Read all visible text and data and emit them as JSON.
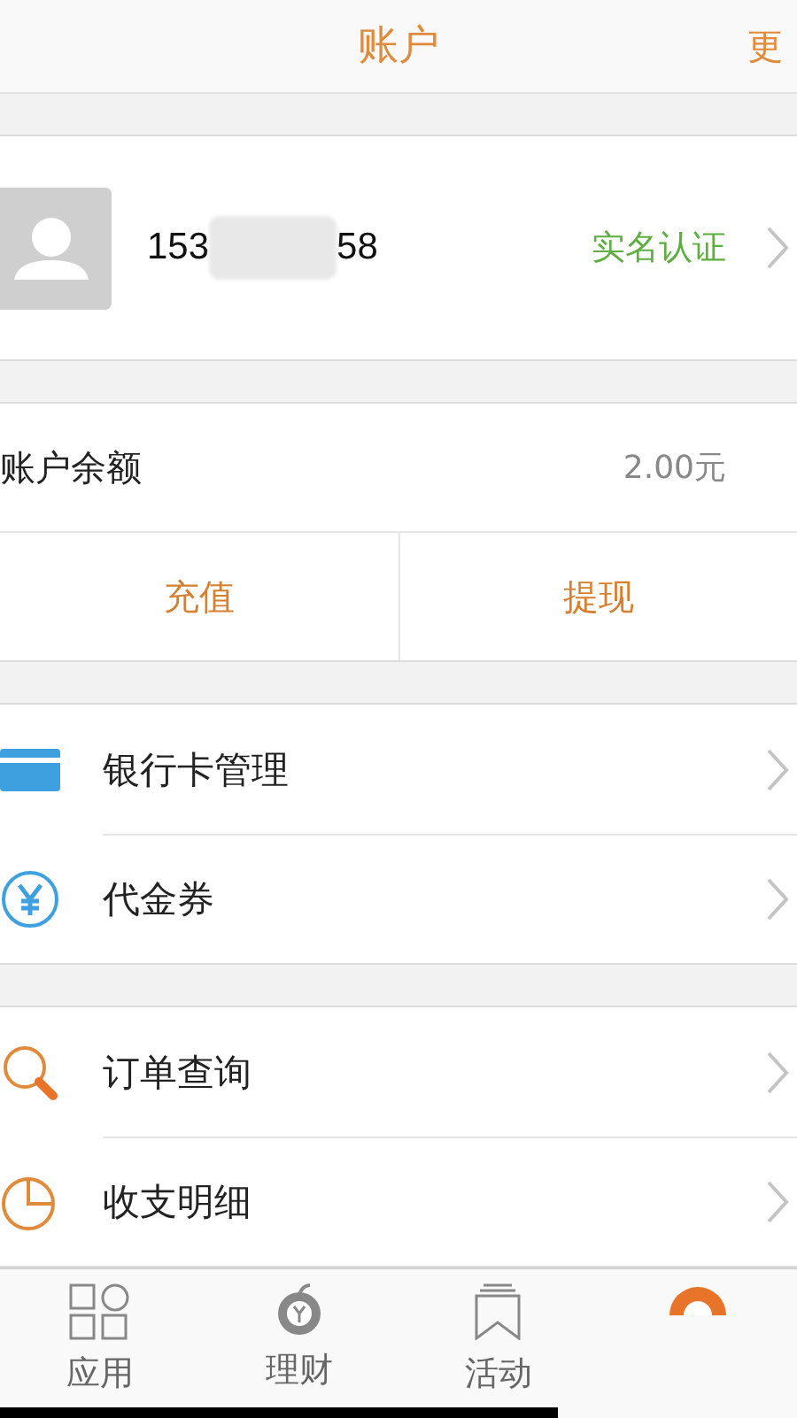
{
  "header": {
    "title": "账户",
    "more": "更"
  },
  "profile": {
    "phone_start": "153",
    "phone_end": "58",
    "verify": "实名认证"
  },
  "balance": {
    "label": "账户余额",
    "amount": "2.00元",
    "actions": [
      "充值",
      "提现"
    ]
  },
  "menu_groups": [
    [
      {
        "kind": "card",
        "label": "银行卡管理"
      },
      {
        "kind": "coupon",
        "label": "代金券"
      }
    ],
    [
      {
        "kind": "search",
        "label": "订单查询"
      },
      {
        "kind": "pie",
        "label": "收支明细"
      }
    ]
  ],
  "tabs": [
    {
      "kind": "apps",
      "label": "应用",
      "selected": false
    },
    {
      "kind": "finance",
      "label": "理财",
      "selected": false
    },
    {
      "kind": "bookmark",
      "label": "活动",
      "selected": false
    },
    {
      "kind": "account",
      "selected": true
    }
  ]
}
